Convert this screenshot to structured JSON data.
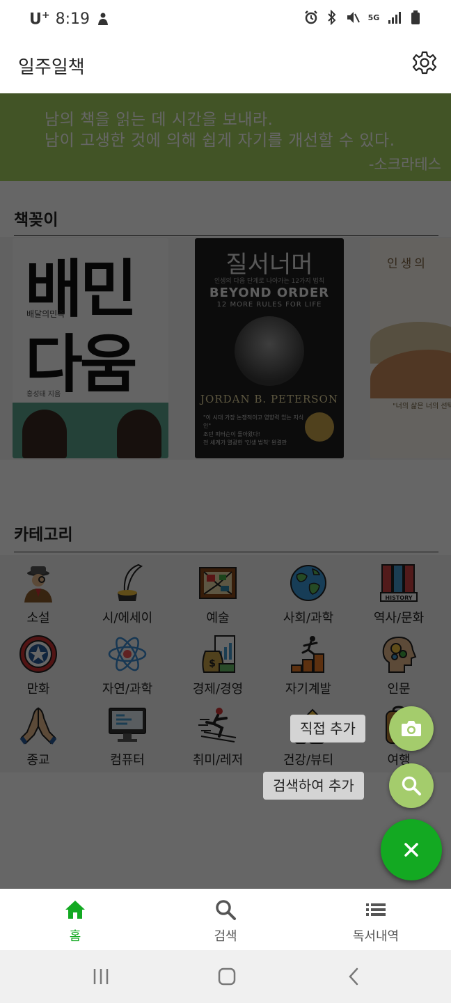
{
  "status_bar": {
    "carrier": "U",
    "carrier_sup": "+",
    "time": "8:19",
    "network": "5G"
  },
  "app_bar": {
    "title": "일주일책",
    "settings_icon": "gear-icon"
  },
  "quote": {
    "line1": "남의 책을 읽는 데 시간을 보내라.",
    "line2": "남이 고생한 것에 의해 쉽게 자기를 개선할 수 있다.",
    "author": "-소크라테스",
    "background": "#a6d35f"
  },
  "bookshelf": {
    "title": "책꽂이",
    "books": [
      {
        "big1": "배민",
        "big2": "다움",
        "subtitle": "배달의민족",
        "author": "홍성태 지음"
      },
      {
        "title_kor": "질서너머",
        "small": "인생의 다음 단계로 나아가는 12가지 법칙",
        "title_en": "BEYOND ORDER",
        "subtitle_en": "12 MORE RULES FOR LIFE",
        "author": "JORDAN B. PETERSON",
        "blurb1": "\"이 시대 가장 논쟁적이고 영향력 있는 지식인\"",
        "blurb2": "조던 피터슨이 돌아왔다!",
        "blurb3": "전 세계가 열광한 '인생 법칙' 완결판"
      },
      {
        "title": "인생의",
        "quote": "\"너의 삶은 너의 선택\""
      }
    ]
  },
  "categories": {
    "title": "카테고리",
    "items": [
      {
        "label": "소설",
        "icon": "detective-icon"
      },
      {
        "label": "시/에세이",
        "icon": "quill-ink-icon"
      },
      {
        "label": "예술",
        "icon": "painting-icon"
      },
      {
        "label": "사회/과학",
        "icon": "globe-icon"
      },
      {
        "label": "역사/문화",
        "icon": "history-books-icon"
      },
      {
        "label": "만화",
        "icon": "shield-star-icon"
      },
      {
        "label": "자연/과학",
        "icon": "atom-icon"
      },
      {
        "label": "경제/경영",
        "icon": "money-bag-icon"
      },
      {
        "label": "자기계발",
        "icon": "stairs-runner-icon"
      },
      {
        "label": "인문",
        "icon": "head-gears-icon"
      },
      {
        "label": "종교",
        "icon": "praying-hands-icon"
      },
      {
        "label": "컴퓨터",
        "icon": "computer-code-icon"
      },
      {
        "label": "취미/레저",
        "icon": "skier-icon"
      },
      {
        "label": "건강/뷰티",
        "icon": "cosmetic-icon"
      },
      {
        "label": "여행",
        "icon": "backpack-icon"
      }
    ]
  },
  "fab_menu": {
    "manual_add_label": "직접 추가",
    "search_add_label": "검색하여 추가",
    "mini_fab_color": "#a4cc6c",
    "main_fab_color": "#13a922"
  },
  "bottom_nav": {
    "items": [
      {
        "label": "홈",
        "icon": "home-icon",
        "active": true
      },
      {
        "label": "검색",
        "icon": "search-icon",
        "active": false
      },
      {
        "label": "독서내역",
        "icon": "list-icon",
        "active": false
      }
    ],
    "accent": "#13a922"
  }
}
